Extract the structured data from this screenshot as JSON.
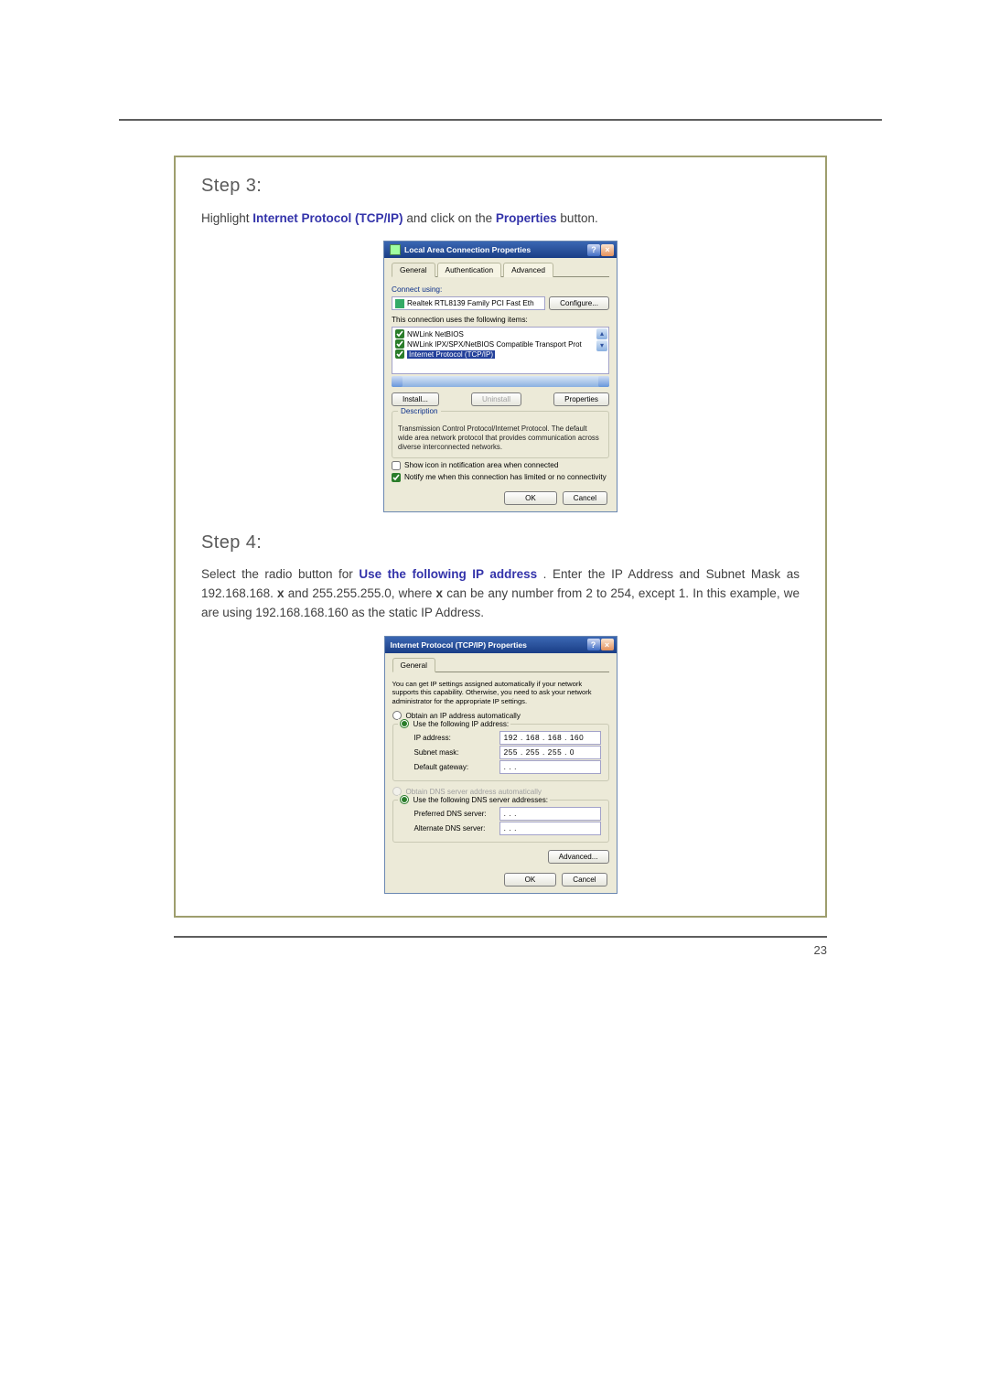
{
  "page_number": "23",
  "step3": {
    "title": "Step 3:",
    "body_prefix": "Highlight ",
    "body_strong1": "Internet Protocol (TCP/IP)",
    "body_mid": " and click on the ",
    "body_strong2": "Properties",
    "body_suffix": " button."
  },
  "lacp": {
    "title": "Local Area Connection Properties",
    "tabs": [
      "General",
      "Authentication",
      "Advanced"
    ],
    "connect_using_label": "Connect using:",
    "adapter": "Realtek RTL8139 Family PCI Fast Eth",
    "configure_btn": "Configure...",
    "items_label": "This connection uses the following items:",
    "items": [
      "NWLink NetBIOS",
      "NWLink IPX/SPX/NetBIOS Compatible Transport Prot",
      "Internet Protocol (TCP/IP)"
    ],
    "install_btn": "Install...",
    "uninstall_btn": "Uninstall",
    "properties_btn": "Properties",
    "desc_legend": "Description",
    "desc_text": "Transmission Control Protocol/Internet Protocol. The default wide area network protocol that provides communication across diverse interconnected networks.",
    "chk_showicon": "Show icon in notification area when connected",
    "chk_notify": "Notify me when this connection has limited or no connectivity",
    "ok": "OK",
    "cancel": "Cancel"
  },
  "step4": {
    "title": "Step 4:",
    "body_prefix": "Select the radio button for ",
    "body_strong1": "Use the following IP address",
    "body_mid1": ". Enter the IP Address and Subnet Mask as 192.168.168.",
    "body_x1": "x",
    "body_mid2": " and 255.255.255.0, where ",
    "body_x2": "x",
    "body_suffix": " can be any number from 2 to 254, except 1. In this example, we are using 192.168.168.160 as the static IP Address."
  },
  "tcpip": {
    "title": "Internet Protocol (TCP/IP) Properties",
    "tab": "General",
    "intro": "You can get IP settings assigned automatically if your network supports this capability. Otherwise, you need to ask your network administrator for the appropriate IP settings.",
    "radio_obtain_ip": "Obtain an IP address automatically",
    "radio_use_ip": "Use the following IP address:",
    "ip_label": "IP address:",
    "ip_value": "192 . 168 . 168 . 160",
    "subnet_label": "Subnet mask:",
    "subnet_value": "255 . 255 . 255 .   0",
    "gateway_label": "Default gateway:",
    "gateway_value": "    .     .     .    ",
    "radio_obtain_dns": "Obtain DNS server address automatically",
    "radio_use_dns": "Use the following DNS server addresses:",
    "pref_dns_label": "Preferred DNS server:",
    "pref_dns_value": "    .     .     .    ",
    "alt_dns_label": "Alternate DNS server:",
    "alt_dns_value": "    .     .     .    ",
    "advanced_btn": "Advanced...",
    "ok": "OK",
    "cancel": "Cancel"
  }
}
